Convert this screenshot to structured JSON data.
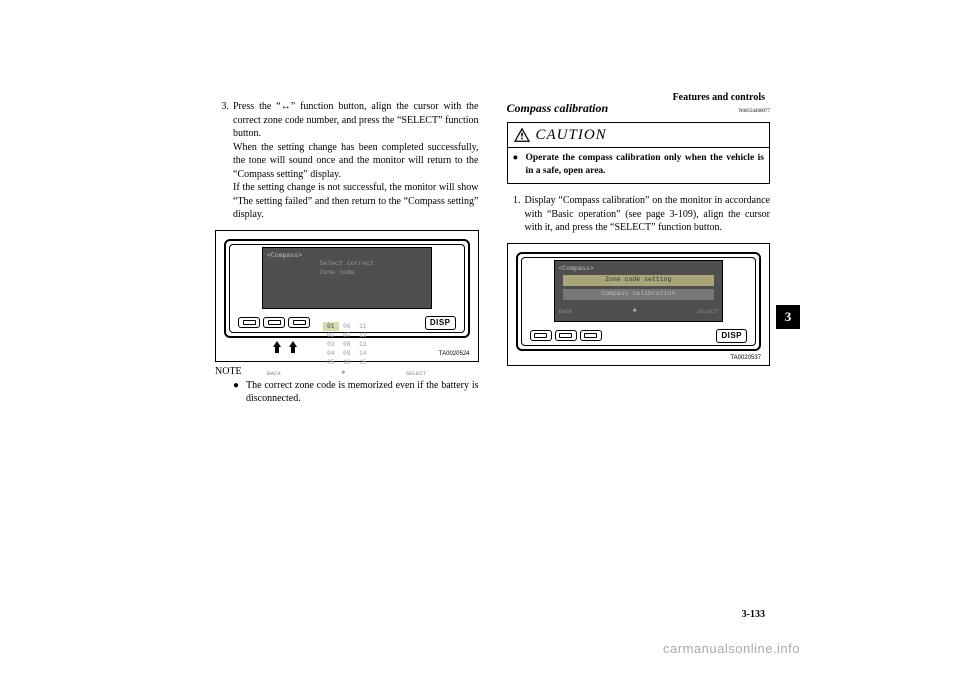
{
  "header": {
    "section": "Features and controls",
    "page_num": "3-133",
    "chapter_tab": "3"
  },
  "left": {
    "step_num": "3.",
    "step_a": "Press the “",
    "step_a_glyph": "↔",
    "step_b": "” function button, align the cursor with the correct zone code number, and press the “SELECT” function button.",
    "para2": "When the setting change has been completed successfully, the tone will sound once and the monitor will return to the “Compass setting” display.",
    "para3": "If the setting change is not successful, the monitor will show “The setting failed” and then return to the “Compass setting” display.",
    "note_label": "NOTE",
    "note_text": "The correct zone code is memorized even if the battery is disconnected."
  },
  "right": {
    "title": "Compass calibration",
    "title_code": "N00534400077",
    "caution_label": "CAUTION",
    "caution_text": "Operate the compass calibration only when the vehicle is in a safe, open area.",
    "step_num": "1.",
    "step_text": "Display “Compass calibration” on the monitor in accordance with “Basic operation” (see page 3-109), align the cursor with it, and press the “SELECT” function button."
  },
  "fig1": {
    "code": "TA0020524",
    "disp": "DISP",
    "screen_title": "<Compass>",
    "screen_msg": "Select correct\nzone code",
    "softbar_back": "BACK",
    "softbar_select": "SELECT",
    "diamond": "◆",
    "zones": [
      "01",
      "06",
      "11",
      "02",
      "07",
      "12",
      "03",
      "08",
      "13",
      "04",
      "09",
      "14",
      "05",
      "10",
      "15"
    ],
    "highlight": 0
  },
  "fig2": {
    "code": "TA0020537",
    "disp": "DISP",
    "screen_title": "<Compass>",
    "menu1": "Zone code setting",
    "menu2": "Compass calibration",
    "softbar_back": "BACK",
    "softbar_select": "SELECT",
    "diamond": "◆"
  },
  "watermark": "carmanualsonline.info"
}
